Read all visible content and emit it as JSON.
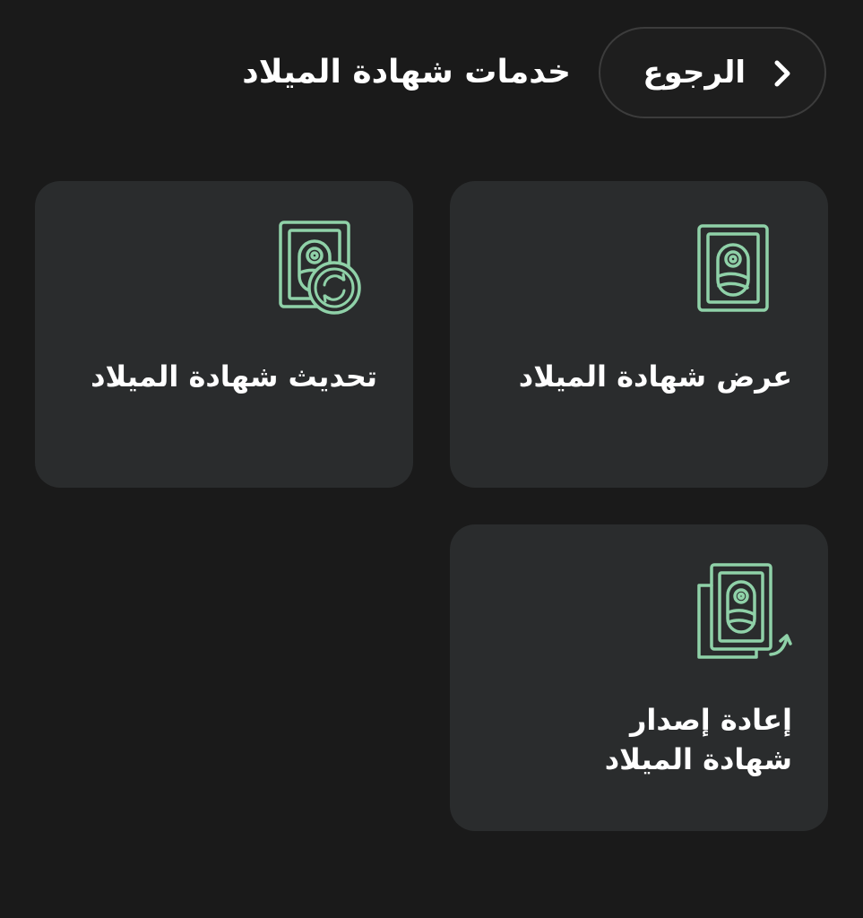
{
  "header": {
    "back_label": "الرجوع",
    "title": "خدمات شهادة الميلاد"
  },
  "cards": [
    {
      "label": "عرض شهادة الميلاد",
      "icon": "birth-certificate-icon"
    },
    {
      "label": "تحديث شهادة الميلاد",
      "icon": "birth-certificate-refresh-icon"
    },
    {
      "label_line1": "إعادة إصدار",
      "label_line2": "شهادة الميلاد",
      "icon": "birth-certificate-reissue-icon"
    }
  ],
  "colors": {
    "background": "#1a1a1a",
    "card": "#2a2c2d",
    "icon_accent": "#8fd1a8",
    "text": "#ffffff"
  }
}
